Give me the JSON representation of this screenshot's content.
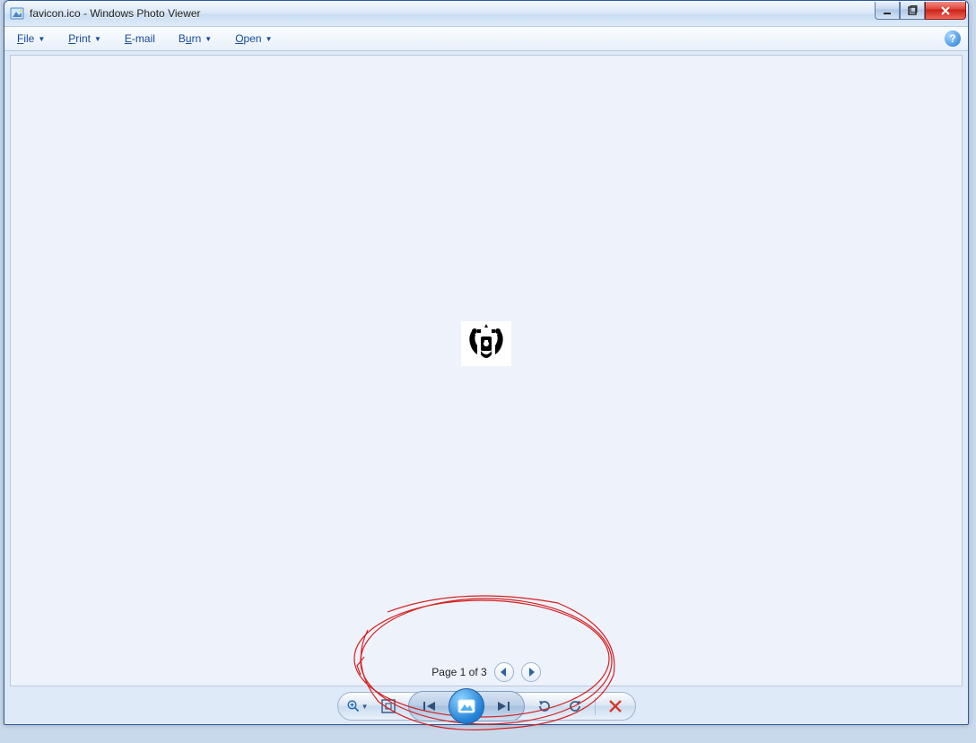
{
  "window": {
    "title": "favicon.ico - Windows Photo Viewer"
  },
  "menu": {
    "items": [
      {
        "pre": "",
        "mnemonic": "F",
        "post": "ile",
        "has_dropdown": true
      },
      {
        "pre": "",
        "mnemonic": "P",
        "post": "rint",
        "has_dropdown": true
      },
      {
        "pre": "",
        "mnemonic": "E",
        "post": "-mail",
        "has_dropdown": false
      },
      {
        "pre": "B",
        "mnemonic": "u",
        "post": "rn",
        "has_dropdown": true
      },
      {
        "pre": "",
        "mnemonic": "O",
        "post": "pen",
        "has_dropdown": true
      }
    ]
  },
  "viewer": {
    "page_label": "Page 1 of 3"
  }
}
